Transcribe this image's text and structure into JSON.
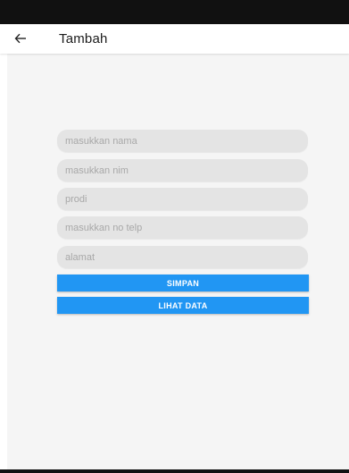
{
  "app_bar": {
    "title": "Tambah",
    "back_icon": "arrow-left-icon"
  },
  "form": {
    "fields": {
      "nama": {
        "placeholder": "masukkan nama",
        "value": ""
      },
      "nim": {
        "placeholder": "masukkan nim",
        "value": ""
      },
      "prodi": {
        "placeholder": "prodi",
        "value": ""
      },
      "telp": {
        "placeholder": "masukkan no telp",
        "value": ""
      },
      "alamat": {
        "placeholder": "alamat",
        "value": ""
      }
    },
    "save_label": "SIMPAN",
    "view_label": "LIHAT DATA"
  },
  "colors": {
    "accent": "#2196f3",
    "field_bg": "#e4e4e4",
    "content_bg": "#f5f5f5",
    "status_bar": "#111111"
  }
}
